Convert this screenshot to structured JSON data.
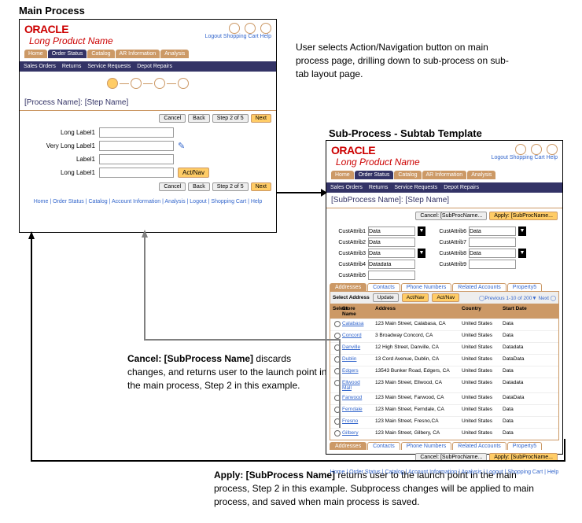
{
  "labels": {
    "main": "Main Process",
    "sub": "Sub-Process - Subtab Template"
  },
  "annotations": {
    "a1": "User selects Action/Navigation button on main process page, drilling down to sub-process on sub-tab layout page.",
    "a2_1": "Cancel: [SubProcess Name]",
    "a2_2": " discards changes, and returns user to the launch point in the main process, Step 2 in this example.",
    "a3_1": "Apply: [SubProcess Name]",
    "a3_2": " returns user to the launch point in the main process, Step 2 in this example. Subprocess changes will be applied to main process, and saved when main process is saved."
  },
  "brand": {
    "logo": "ORACLE",
    "product": "Long Product Name",
    "util": "Logout  Shopping Cart  Help"
  },
  "tabs": [
    "Home",
    "Order Status",
    "Catalog",
    "AR Information",
    "Analysis"
  ],
  "blue_main": [
    "Sales Orders",
    "Returns",
    "Service Requests",
    "Depot Repairs"
  ],
  "blue_sub": [
    "Sales Orders",
    "Returns",
    "Service Requests",
    "Depot Repairs"
  ],
  "main_title": "[Process Name]: [Step Name]",
  "sub_title": "[SubProcess Name]: [Step Name]",
  "btns_main_top": [
    "Cancel",
    "Back",
    "Step 2 of 5",
    "Next"
  ],
  "btns_main_bot": [
    "Cancel",
    "Back",
    "Step 2 of 5",
    "Next"
  ],
  "btns_sub": {
    "cancel": "Cancel: [SubProcName...",
    "apply": "Apply: [SubProcName..."
  },
  "form_main": [
    {
      "label": "Long Label1"
    },
    {
      "label": "Very Long Label1"
    },
    {
      "label": "Label1"
    },
    {
      "label": "Long Label1",
      "act": "Act/Nav"
    }
  ],
  "attrs_left": [
    {
      "l": "CustAttrib1",
      "v": "Data",
      "dd": true
    },
    {
      "l": "CustAttrib2",
      "v": "Data"
    },
    {
      "l": "CustAttrib3",
      "v": "Data",
      "dd": true
    },
    {
      "l": "CustAttrib4",
      "v": "Datadata"
    },
    {
      "l": "CustAttrib5",
      "v": ""
    }
  ],
  "attrs_right": [
    {
      "l": "CustAttrib6",
      "v": "Data",
      "dd": true
    },
    {
      "l": "CustAttrib7",
      "v": ""
    },
    {
      "l": "CustAttrib8",
      "v": "Data",
      "dd": true
    },
    {
      "l": "CustAttrib9",
      "v": ""
    }
  ],
  "subtabs": [
    "Addresses",
    "Contacts",
    "Phone Numbers",
    "Related Accounts",
    "Property5"
  ],
  "table": {
    "pick": "Select Address",
    "upd": "Update",
    "an1": "Act/Nav",
    "an2": "Act/Nav",
    "nav": "◯Previous 1-10 of 200▼ Next ◯",
    "cols": [
      "Select",
      "Store Name",
      "Address",
      "Country",
      "Start Date"
    ],
    "rows": [
      {
        "n": "Calabasa",
        "a": "123 Main Street, Calabasa, CA",
        "c": "United States",
        "s": "Data"
      },
      {
        "n": "Concord",
        "a": "3 Broadway Concord, CA",
        "c": "United States",
        "s": "Data"
      },
      {
        "n": "Danville",
        "a": "12 High Street, Danville, CA",
        "c": "United States",
        "s": "Datadata"
      },
      {
        "n": "Dublin",
        "a": "13 Cord Avenue, Dublin, CA",
        "c": "United States",
        "s": "DataData"
      },
      {
        "n": "Edgers",
        "a": "13543 Bunker Road, Edgers, CA",
        "c": "United States",
        "s": "Data"
      },
      {
        "n": "Ellwood Mall",
        "a": "123 Main Street, Ellwood, CA",
        "c": "United States",
        "s": "Datadata"
      },
      {
        "n": "Farwood",
        "a": "123 Main Street, Farwood, CA",
        "c": "United States",
        "s": "DataData"
      },
      {
        "n": "Ferndale",
        "a": "123 Main Street, Ferndale, CA",
        "c": "United States",
        "s": "Data"
      },
      {
        "n": "Fresno",
        "a": "123 Main Street, Fresno,CA",
        "c": "United States",
        "s": "Data"
      },
      {
        "n": "Gilbery",
        "a": "123 Main Street, Gilbery, CA",
        "c": "United States",
        "s": "Data"
      }
    ]
  },
  "footer": "Home  |  Order Status  | Catalog  |  Account Information  |  Analysis  |  Logout  |  Shopping Cart  |  Help"
}
